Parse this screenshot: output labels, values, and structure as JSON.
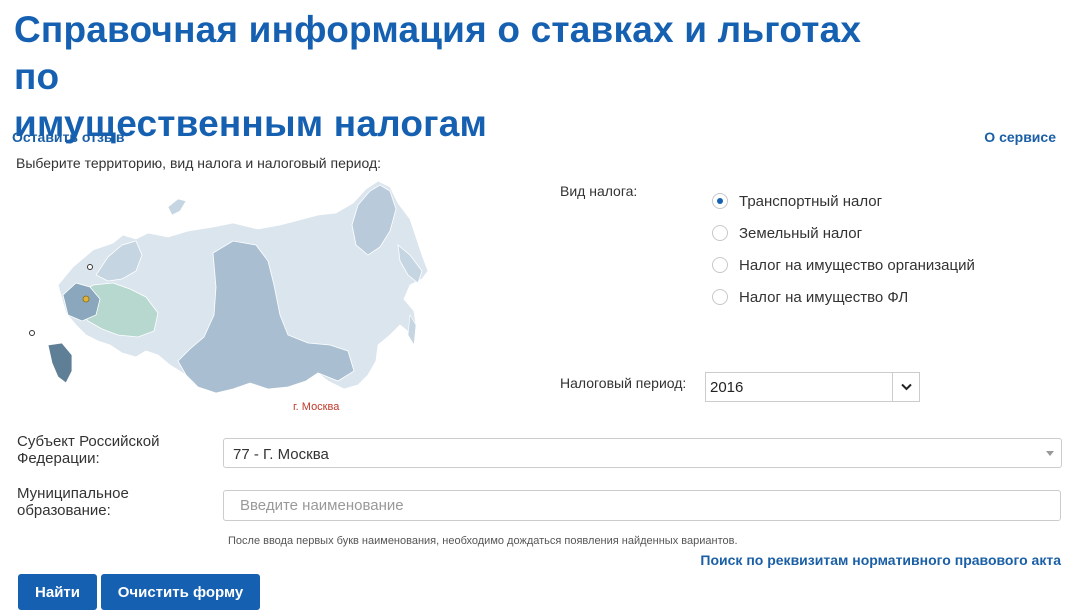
{
  "header": {
    "title_line1": "Справочная информация о ставках и льготах по",
    "title_line2": "имущественным налогам"
  },
  "links": {
    "feedback": "Оставить отзыв",
    "about": "О сервисе",
    "requisites_search": "Поиск по реквизитам нормативного правового акта"
  },
  "instruction": "Выберите территорию, вид налога и налоговый период:",
  "map": {
    "caption": "г. Москва",
    "colors": {
      "light": "#dbe5ee",
      "medium": "#a9bfd1",
      "dark": "#8aa7bd",
      "green": "#b7d8cf",
      "highlight": "#5f7f96"
    }
  },
  "tax_type": {
    "label": "Вид налога:",
    "options": [
      {
        "label": "Транспортный налог",
        "selected": true
      },
      {
        "label": "Земельный налог",
        "selected": false
      },
      {
        "label": "Налог на имущество организаций",
        "selected": false
      },
      {
        "label": "Налог на имущество ФЛ",
        "selected": false
      }
    ]
  },
  "tax_period": {
    "label": "Налоговый период:",
    "value": "2016",
    "icon": "chevron-down-icon"
  },
  "subject": {
    "label_line1": "Субъект Российской",
    "label_line2": "Федерации:",
    "value": "77 - Г. Москва"
  },
  "municipal": {
    "label_line1": "Муниципальное",
    "label_line2": "образование:",
    "placeholder": "Введите наименование",
    "value": "",
    "hint": "После ввода первых букв наименования, необходимо дождаться появления найденных вариантов."
  },
  "buttons": {
    "find": "Найти",
    "clear": "Очистить форму"
  },
  "theme": {
    "accent": "#1660b2",
    "link": "#1a5fa6",
    "caption_red": "#c0392b"
  }
}
